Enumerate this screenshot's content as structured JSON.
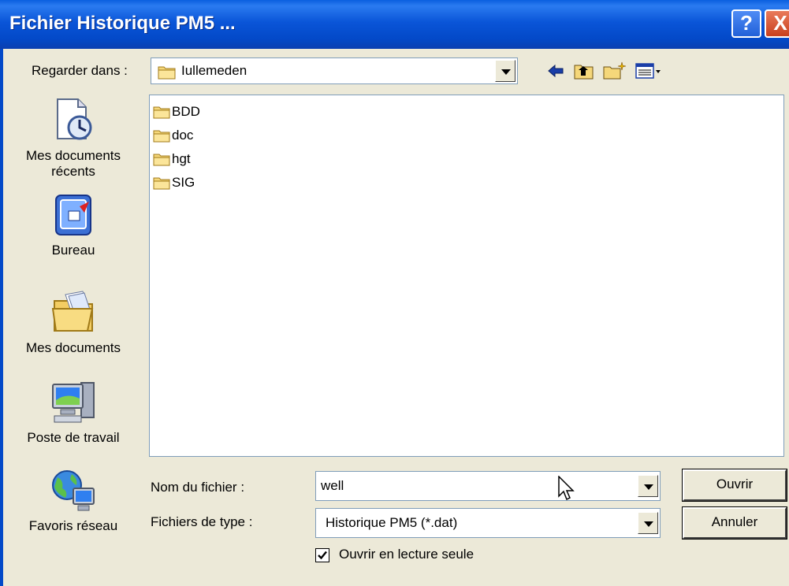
{
  "window": {
    "title": "Fichier Historique PM5 ...",
    "help_label": "?",
    "close_label": "X"
  },
  "look_in": {
    "label": "Regarder dans :",
    "value": "Iullemeden"
  },
  "toolbar": {
    "icons": [
      "back-arrow-icon",
      "up-folder-icon",
      "new-folder-icon",
      "view-menu-icon"
    ]
  },
  "places": [
    {
      "label": "Mes documents récents",
      "icon": "recent-documents-icon"
    },
    {
      "label": "Bureau",
      "icon": "desktop-icon"
    },
    {
      "label": "Mes documents",
      "icon": "my-documents-icon"
    },
    {
      "label": "Poste de travail",
      "icon": "my-computer-icon"
    },
    {
      "label": "Favoris réseau",
      "icon": "network-places-icon"
    }
  ],
  "files": [
    "BDD",
    "doc",
    "hgt",
    "SIG"
  ],
  "filename": {
    "label": "Nom du fichier :",
    "value": "well"
  },
  "filetype": {
    "label": "Fichiers de type :",
    "value": "Historique PM5 (*.dat)"
  },
  "buttons": {
    "open": "Ouvrir",
    "cancel": "Annuler"
  },
  "readonly": {
    "label": "Ouvrir en lecture seule",
    "checked": true
  },
  "colors": {
    "titlebar": "#0a55d8",
    "dialog_bg": "#ece9d8",
    "folder": "#f5d77a"
  }
}
